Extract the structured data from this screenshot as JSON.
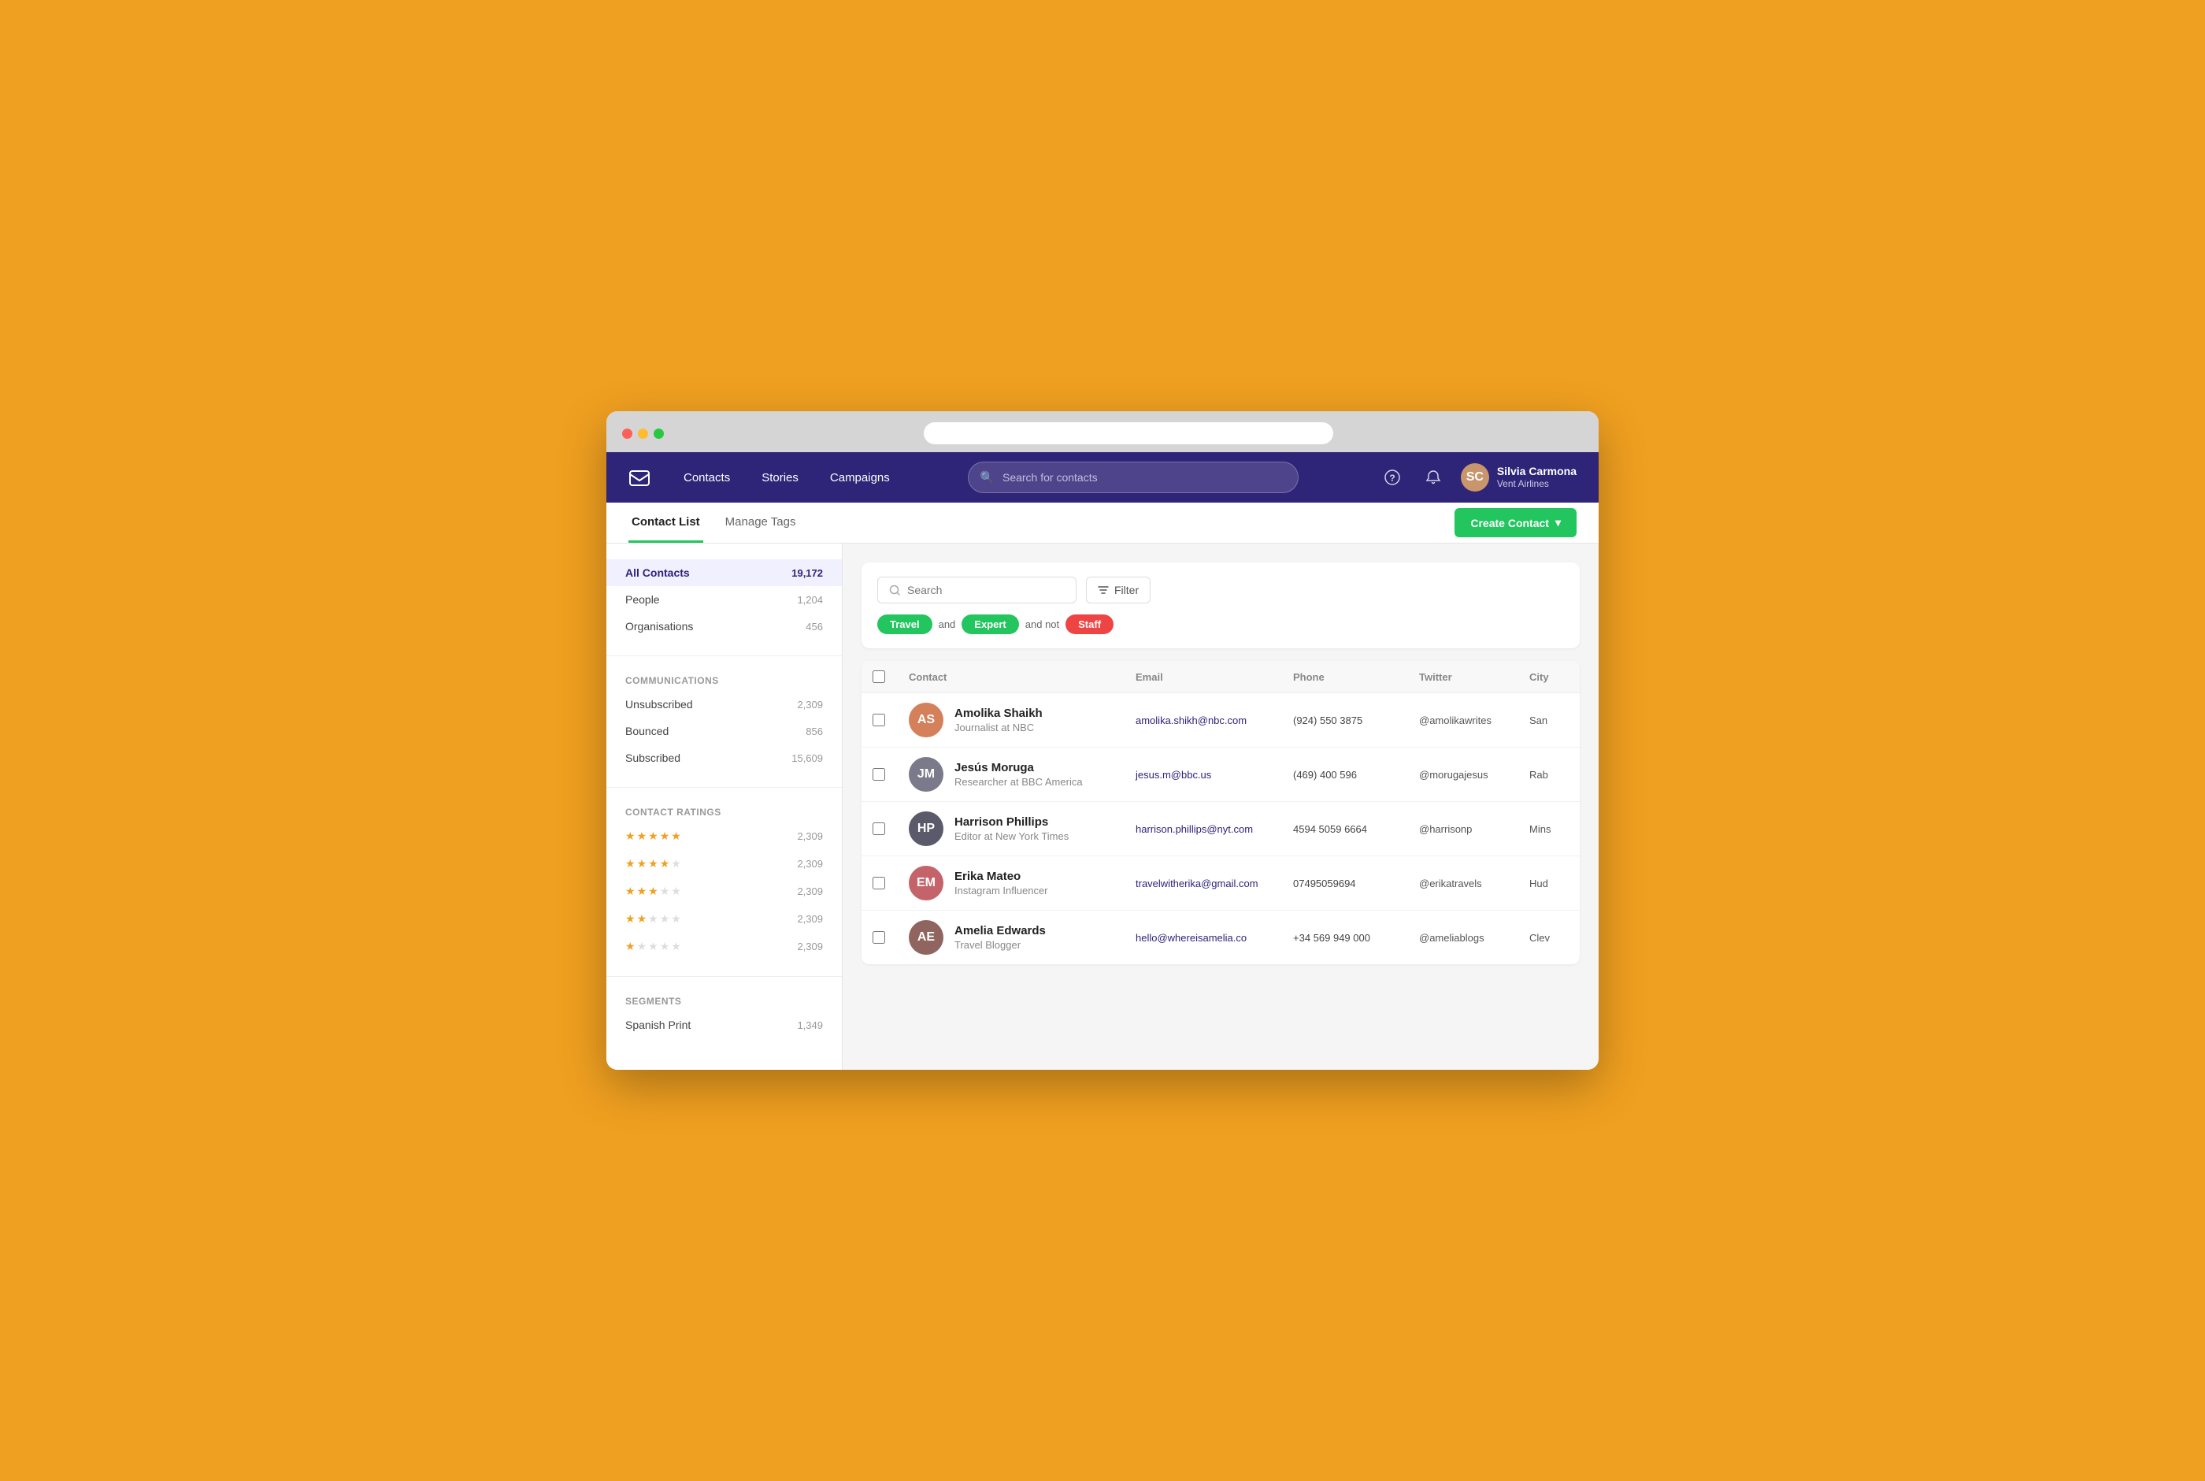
{
  "browser": {
    "addressbar_placeholder": ""
  },
  "nav": {
    "logo_label": "Mail",
    "links": [
      {
        "label": "Contacts",
        "id": "contacts"
      },
      {
        "label": "Stories",
        "id": "stories"
      },
      {
        "label": "Campaigns",
        "id": "campaigns"
      }
    ],
    "search_placeholder": "Search for contacts",
    "help_icon": "?",
    "bell_icon": "🔔",
    "user": {
      "name": "Silvia Carmona",
      "company": "Vent Airlines",
      "initials": "SC"
    }
  },
  "subnav": {
    "tabs": [
      {
        "label": "Contact List",
        "active": true
      },
      {
        "label": "Manage Tags",
        "active": false
      }
    ],
    "create_button": "Create Contact"
  },
  "sidebar": {
    "contacts_section": {
      "items": [
        {
          "label": "All Contacts",
          "count": "19,172",
          "active": true
        },
        {
          "label": "People",
          "count": "1,204",
          "active": false
        },
        {
          "label": "Organisations",
          "count": "456",
          "active": false
        }
      ]
    },
    "communications_section": {
      "title": "Communications",
      "items": [
        {
          "label": "Unsubscribed",
          "count": "2,309"
        },
        {
          "label": "Bounced",
          "count": "856"
        },
        {
          "label": "Subscribed",
          "count": "15,609"
        }
      ]
    },
    "ratings_section": {
      "title": "Contact Ratings",
      "items": [
        {
          "stars": 5,
          "count": "2,309"
        },
        {
          "stars": 4,
          "count": "2,309"
        },
        {
          "stars": 3,
          "count": "2,309"
        },
        {
          "stars": 2,
          "count": "2,309"
        },
        {
          "stars": 1,
          "count": "2,309"
        }
      ]
    },
    "segments_section": {
      "title": "Segments",
      "items": [
        {
          "label": "Spanish Print",
          "count": "1,349"
        }
      ]
    }
  },
  "filter": {
    "search_placeholder": "Search",
    "filter_label": "Filter",
    "active_filters": [
      {
        "label": "Travel",
        "type": "travel",
        "operator_before": "",
        "operator_after": "and"
      },
      {
        "label": "Expert",
        "type": "expert",
        "operator_before": "",
        "operator_after": "and not"
      },
      {
        "label": "Staff",
        "type": "staff",
        "operator_before": "",
        "operator_after": ""
      }
    ]
  },
  "table": {
    "columns": [
      "Contact",
      "Email",
      "Phone",
      "Twitter",
      "City"
    ],
    "rows": [
      {
        "id": 1,
        "name": "Amolika Shaikh",
        "role": "Journalist at NBC",
        "email": "amolika.shikh@nbc.com",
        "phone": "(924) 550 3875",
        "twitter": "@amolikawrites",
        "city": "San",
        "avatar_color": "av-orange",
        "initials": "AS"
      },
      {
        "id": 2,
        "name": "Jesús Moruga",
        "role": "Researcher at BBC America",
        "email": "jesus.m@bbc.us",
        "phone": "(469) 400 596",
        "twitter": "@morugajesus",
        "city": "Rab",
        "avatar_color": "av-gray",
        "initials": "JM"
      },
      {
        "id": 3,
        "name": "Harrison Phillips",
        "role": "Editor at New York Times",
        "email": "harrison.phillips@nyt.com",
        "phone": "4594 5059 6664",
        "twitter": "@harrisonp",
        "city": "Mins",
        "avatar_color": "av-darkgray",
        "initials": "HP"
      },
      {
        "id": 4,
        "name": "Erika Mateo",
        "role": "Instagram Influencer",
        "email": "travelwitherika@gmail.com",
        "phone": "07495059694",
        "twitter": "@erikatravels",
        "city": "Hud",
        "avatar_color": "av-pink",
        "initials": "EM"
      },
      {
        "id": 5,
        "name": "Amelia Edwards",
        "role": "Travel Blogger",
        "email": "hello@whereisamelia.co",
        "phone": "+34 569 949 000",
        "twitter": "@ameliablogs",
        "city": "Clev",
        "avatar_color": "av-brown",
        "initials": "AE"
      }
    ]
  }
}
